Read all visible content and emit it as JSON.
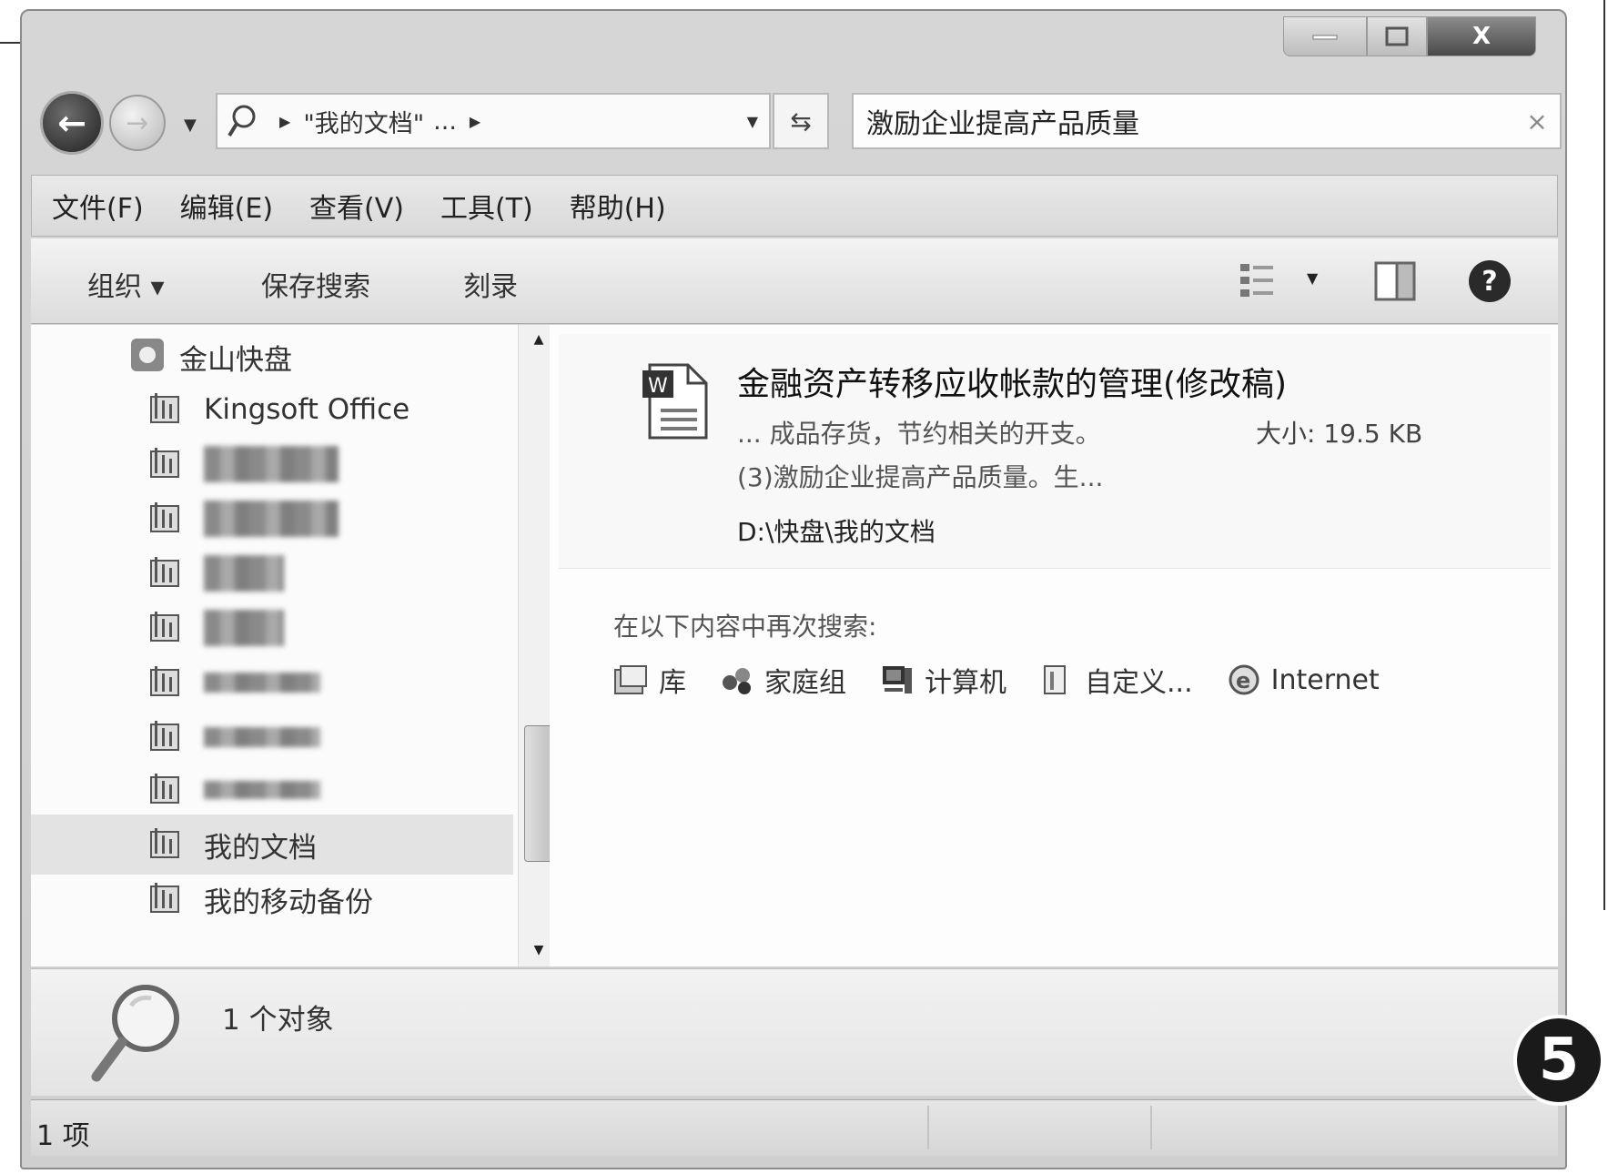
{
  "window": {
    "minimize_icon": "minimize-icon",
    "maximize_icon": "maximize-icon",
    "close_label": "X"
  },
  "navigation": {
    "back_icon": "back-arrow-icon",
    "forward_icon": "forward-arrow-icon",
    "address_breadcrumb": "\"我的文档\"",
    "address_ellipsis": "...",
    "refresh_icon": "refresh-icon"
  },
  "search": {
    "value": "激励企业提高产品质量",
    "clear_label": "×"
  },
  "menu": {
    "items": [
      "文件(F)",
      "编辑(E)",
      "查看(V)",
      "工具(T)",
      "帮助(H)"
    ]
  },
  "toolbar": {
    "organize_label": "组织 ▾",
    "save_search_label": "保存搜索",
    "burn_label": "刻录",
    "help_label": "?"
  },
  "sidebar": {
    "root_label": "金山快盘",
    "items": [
      {
        "label": "Kingsoft Office",
        "blurred": false
      },
      {
        "label": "",
        "blurred": true
      },
      {
        "label": "",
        "blurred": true
      },
      {
        "label": "",
        "blurred": true
      },
      {
        "label": "",
        "blurred": true
      },
      {
        "label": "",
        "blurred": true
      },
      {
        "label": "",
        "blurred": true
      },
      {
        "label": "",
        "blurred": true
      },
      {
        "label": "我的文档",
        "blurred": false,
        "selected": true
      },
      {
        "label": "我的移动备份",
        "blurred": false
      }
    ]
  },
  "result": {
    "title": "金融资产转移应收帐款的管理(修改稿)",
    "snippet_line1": "... 成品存货，节约相关的开支。",
    "size_text": "大小: 19.5 KB",
    "snippet_line2": "(3)激励企业提高产品质量。生...",
    "path": "D:\\快盘\\我的文档"
  },
  "search_again": {
    "label": "在以下内容中再次搜索:",
    "scopes": [
      "库",
      "家庭组",
      "计算机",
      "自定义...",
      "Internet"
    ]
  },
  "details": {
    "count_text": "1 个对象"
  },
  "status": {
    "count_text": "1 项"
  },
  "annotation": {
    "step": "5"
  }
}
